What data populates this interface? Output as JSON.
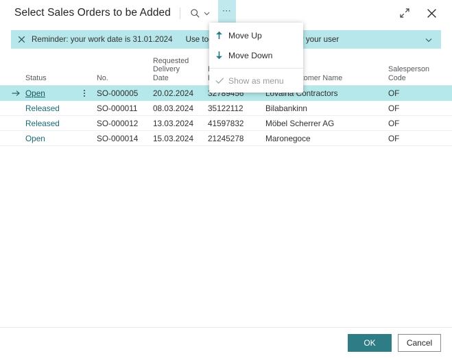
{
  "dialog": {
    "title": "Select Sales Orders to be Added"
  },
  "titlebar": {
    "search_icon": "search-icon",
    "search_chevron_icon": "chevron-down-icon",
    "ellipsis_label": "•••",
    "expand_icon": "expand-icon",
    "close_icon": "close-icon"
  },
  "reminder": {
    "close_icon": "close-icon",
    "text": "Reminder: your work date is 31.01.2024",
    "action_use_today": "Use today",
    "separator": "|",
    "action_change": "Change work date for your user",
    "chevron_icon": "chevron-down-icon",
    "background": "#b7e7ea"
  },
  "menu": {
    "items": [
      {
        "label": "Move Up",
        "icon": "arrow-up-icon",
        "glyph": "↑",
        "disabled": false
      },
      {
        "label": "Move Down",
        "icon": "arrow-down-icon",
        "glyph": "↓",
        "disabled": false
      },
      {
        "label": "Show as menu",
        "icon": "checkmark-icon",
        "glyph": "✓",
        "disabled": true
      }
    ]
  },
  "table": {
    "columns": [
      {
        "label": "Status"
      },
      {
        "label": "No."
      },
      {
        "label": "Requested Delivery Date"
      },
      {
        "label": "External Document No."
      },
      {
        "label": "Sell-to Customer Name"
      },
      {
        "label": "Salesperson Code"
      }
    ],
    "rows": [
      {
        "status": "Open",
        "no": "SO-000005",
        "requested_delivery_date": "20.02.2024",
        "external_document_no": "32789456",
        "customer_name": "Lovaina Contractors",
        "salesperson_code": "OF",
        "selected": true
      },
      {
        "status": "Released",
        "no": "SO-000011",
        "requested_delivery_date": "08.03.2024",
        "external_document_no": "35122112",
        "customer_name": "Bilabankinn",
        "salesperson_code": "OF",
        "selected": false
      },
      {
        "status": "Released",
        "no": "SO-000012",
        "requested_delivery_date": "13.03.2024",
        "external_document_no": "41597832",
        "customer_name": "Möbel Scherrer AG",
        "salesperson_code": "OF",
        "selected": false
      },
      {
        "status": "Open",
        "no": "SO-000014",
        "requested_delivery_date": "15.03.2024",
        "external_document_no": "21245278",
        "customer_name": "Maronegoce",
        "salesperson_code": "OF",
        "selected": false
      }
    ]
  },
  "footer": {
    "ok_label": "OK",
    "cancel_label": "Cancel"
  },
  "colors": {
    "accent": "#2e7d86",
    "highlight": "#b5e8ea",
    "notification": "#b7e7ea"
  }
}
